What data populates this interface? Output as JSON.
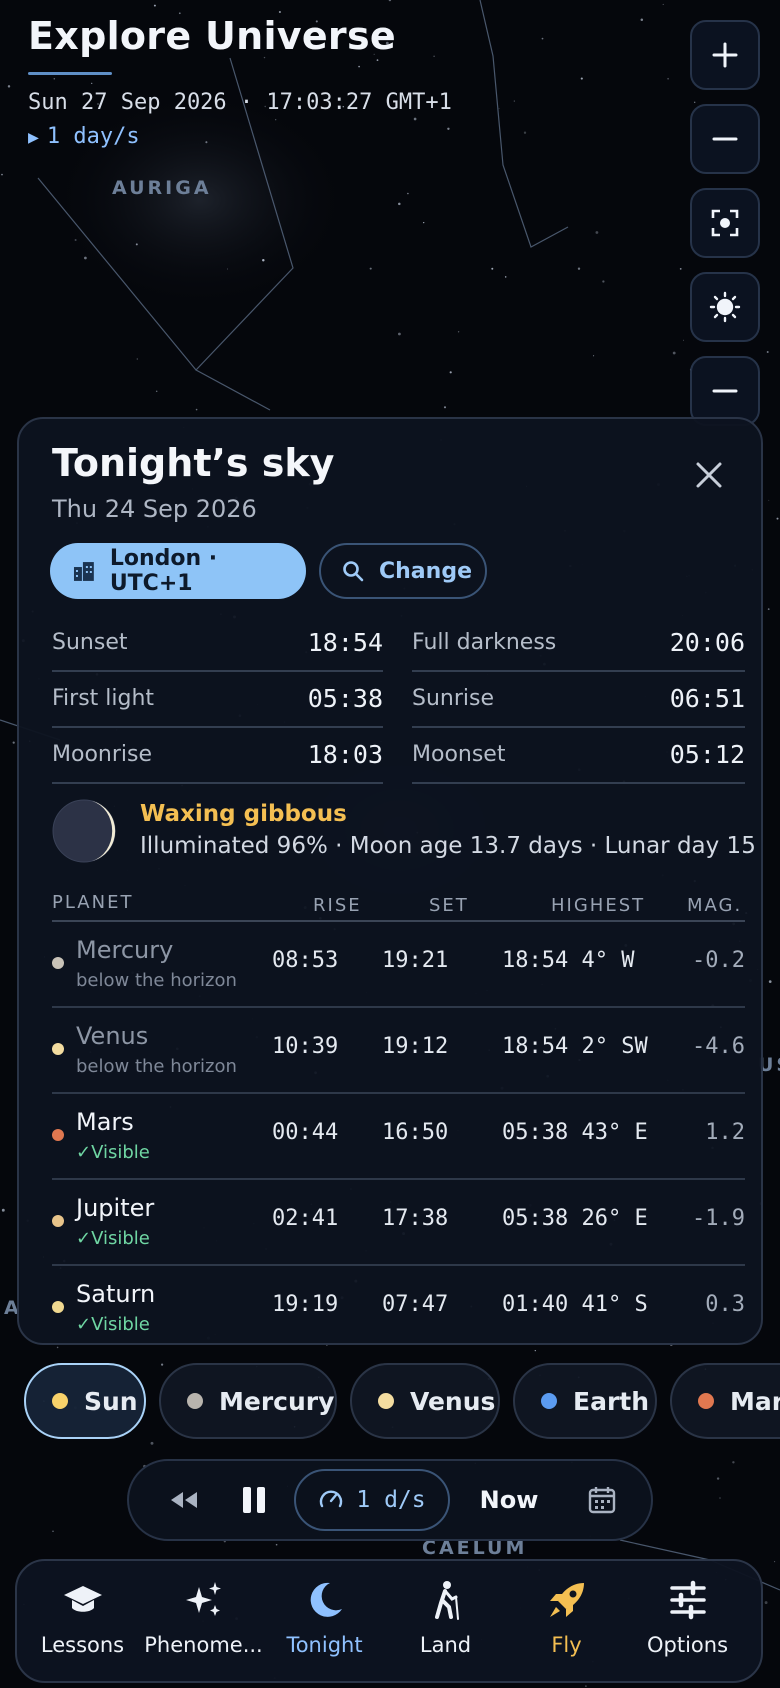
{
  "header": {
    "title": "Explore Universe",
    "datetime": "Sun 27 Sep 2026 · 17:03:27 GMT+1",
    "rate": "1 day/s"
  },
  "constellations": [
    "AURIGA",
    "CAELUM",
    "A",
    "US"
  ],
  "controls": [
    {
      "name": "zoom-in-button",
      "icon": "plus-icon",
      "glyph": "+"
    },
    {
      "name": "zoom-out-button",
      "icon": "minus-icon",
      "glyph": "−"
    },
    {
      "name": "recenter-button",
      "icon": "focus-icon"
    },
    {
      "name": "brightness-button",
      "icon": "sun-icon"
    },
    {
      "name": "collapse-button",
      "icon": "minus-icon",
      "glyph": "−"
    }
  ],
  "panel": {
    "title": "Tonight’s sky",
    "date": "Thu 24 Sep 2026",
    "location_chip": "London · UTC+1",
    "change_chip": "Change",
    "times": [
      {
        "label": "Sunset",
        "value": "18:54"
      },
      {
        "label": "Full darkness",
        "value": "20:06"
      },
      {
        "label": "First light",
        "value": "05:38"
      },
      {
        "label": "Sunrise",
        "value": "06:51"
      },
      {
        "label": "Moonrise",
        "value": "18:03"
      },
      {
        "label": "Moonset",
        "value": "05:12"
      }
    ],
    "moon": {
      "phase": "Waxing gibbous",
      "info": "Illuminated 96% · Moon age 13.7 days · Lunar day 15"
    },
    "planet_headers": {
      "planet": "PLANET",
      "rise": "RISE",
      "set": "SET",
      "highest": "HIGHEST",
      "mag": "MAG."
    },
    "planets": [
      {
        "name": "Mercury",
        "status": "below the horizon",
        "visible": false,
        "rise": "08:53",
        "set": "19:21",
        "highest": "18:54  4° W",
        "mag": "-0.2",
        "color": "#c9c3b8"
      },
      {
        "name": "Venus",
        "status": "below the horizon",
        "visible": false,
        "rise": "10:39",
        "set": "19:12",
        "highest": "18:54  2° SW",
        "mag": "-4.6",
        "color": "#f3dca0"
      },
      {
        "name": "Mars",
        "status": "✓Visible",
        "visible": true,
        "rise": "00:44",
        "set": "16:50",
        "highest": "05:38 43° E",
        "mag": "1.2",
        "color": "#e07850"
      },
      {
        "name": "Jupiter",
        "status": "✓Visible",
        "visible": true,
        "rise": "02:41",
        "set": "17:38",
        "highest": "05:38 26° E",
        "mag": "-1.9",
        "color": "#e8c48a"
      },
      {
        "name": "Saturn",
        "status": "✓Visible",
        "visible": true,
        "rise": "19:19",
        "set": "07:47",
        "highest": "01:40 41° S",
        "mag": "0.3",
        "color": "#f0d890"
      }
    ]
  },
  "planet_chips": [
    {
      "name": "Sun",
      "color": "#f8d26a",
      "active": true
    },
    {
      "name": "Mercury",
      "color": "#b8b4ad",
      "active": false
    },
    {
      "name": "Venus",
      "color": "#f3dca0",
      "active": false
    },
    {
      "name": "Earth",
      "color": "#5b9bf0",
      "active": false
    },
    {
      "name": "Mars",
      "color": "#e07850",
      "active": false
    }
  ],
  "playback": {
    "speed": "1 d/s",
    "now": "Now"
  },
  "nav": [
    {
      "label": "Lessons",
      "icon": "graduation-cap-icon",
      "color": "#eef2f8"
    },
    {
      "label": "Phenome...",
      "icon": "sparkles-icon",
      "color": "#eef2f8"
    },
    {
      "label": "Tonight",
      "icon": "moon-icon",
      "color": "#8fc1ff"
    },
    {
      "label": "Land",
      "icon": "hiker-icon",
      "color": "#eef2f8"
    },
    {
      "label": "Fly",
      "icon": "rocket-icon",
      "color": "#f4bf52"
    },
    {
      "label": "Options",
      "icon": "sliders-icon",
      "color": "#eef2f8"
    }
  ]
}
